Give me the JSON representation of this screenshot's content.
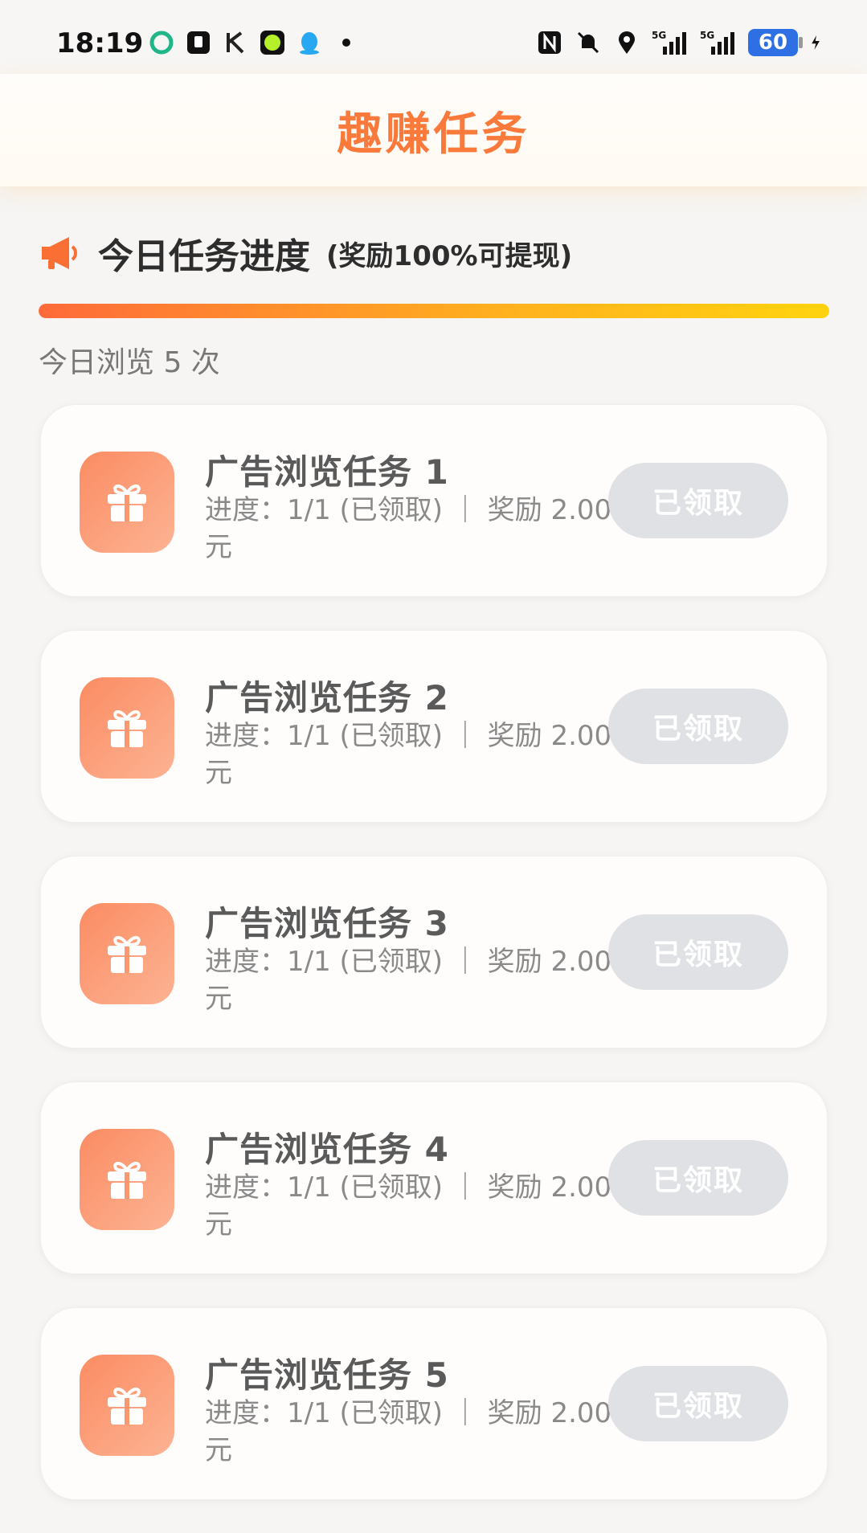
{
  "status_bar": {
    "time": "18:19",
    "battery": "60",
    "left_icons": [
      "app-icon-1",
      "app-icon-2",
      "app-icon-k",
      "app-icon-green",
      "qq-icon",
      "dot-icon"
    ],
    "right_icons": [
      "nfc-icon",
      "bell-muted-icon",
      "location-icon",
      "signal-5g-icon",
      "signal-5g-icon-2"
    ]
  },
  "header": {
    "title": "趣赚任务"
  },
  "progress": {
    "title": "今日任务进度",
    "note": "(奖励100%可提现)",
    "fill_fraction": 1.0,
    "views_text": "今日浏览 5 次"
  },
  "tasks": [
    {
      "name": "广告浏览任务 1",
      "detail": "进度：1/1 (已领取) ｜ 奖励 2.00 元",
      "button": "已领取"
    },
    {
      "name": "广告浏览任务 2",
      "detail": "进度：1/1 (已领取) ｜ 奖励 2.00 元",
      "button": "已领取"
    },
    {
      "name": "广告浏览任务 3",
      "detail": "进度：1/1 (已领取) ｜ 奖励 2.00 元",
      "button": "已领取"
    },
    {
      "name": "广告浏览任务 4",
      "detail": "进度：1/1 (已领取) ｜ 奖励 2.00 元",
      "button": "已领取"
    },
    {
      "name": "广告浏览任务 5",
      "detail": "进度：1/1 (已领取) ｜ 奖励 2.00 元",
      "button": "已领取"
    }
  ],
  "colors": {
    "accent": "#fa7a3c",
    "gift_gradient_start": "#fb8c63",
    "gift_gradient_end": "#fcb393",
    "claimed_button": "#dfe1e5"
  }
}
